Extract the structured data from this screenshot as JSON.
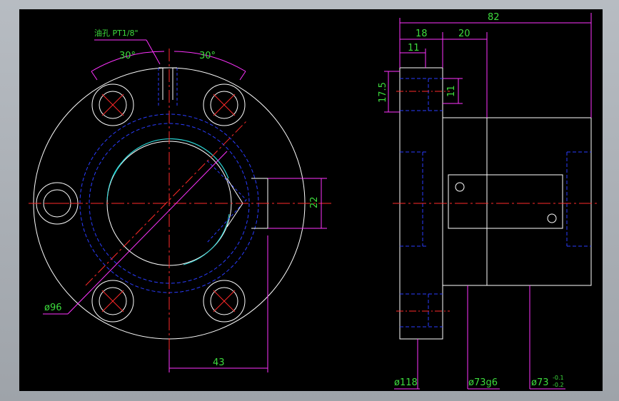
{
  "colors": {
    "canvas_bg": "#000000",
    "outline": "#ffffff",
    "center_line": "#ff2a2a",
    "hidden_line": "#2a3cff",
    "dimension_line": "#ff33ff",
    "dimension_text": "#3ddc3d",
    "highlight": "#2ad6d6"
  },
  "front_view": {
    "oil_hole_label": "油孔 PT1/8\"",
    "angle_left": "30°",
    "angle_right": "30°",
    "dim_keyway_height": "22",
    "dim_outer_diameter": "ø96",
    "dim_offset": "43"
  },
  "side_view": {
    "dim_total_length": "82",
    "dim_flange_width": "18",
    "dim_body_step": "20",
    "dim_hole_depth": "11",
    "dim_hole_spacing": "17.5",
    "dim_counterbore": "11",
    "dim_flange_diameter": "ø118",
    "dim_body_fit": "ø73g6",
    "dim_body_diameter": "ø73",
    "dim_body_tol_upper": "-0.1",
    "dim_body_tol_lower": "-0.2"
  }
}
